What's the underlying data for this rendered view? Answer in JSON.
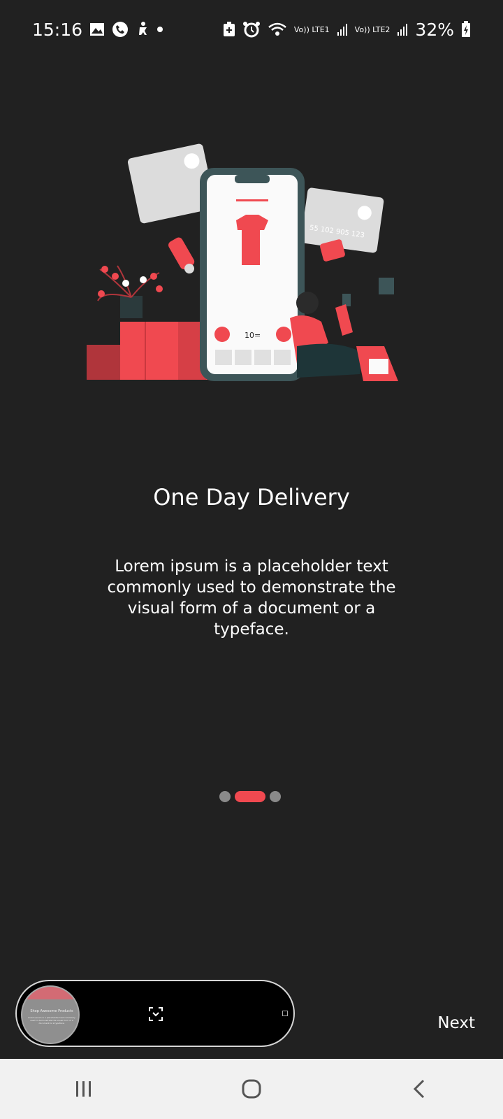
{
  "status": {
    "time": "15:16",
    "battery": "32%",
    "lte1": "Vo)) LTE1",
    "lte2": "Vo)) LTE2"
  },
  "screen": {
    "title": "One Day Delivery",
    "description": "Lorem ipsum is a placeholder text commonly used to demonstrate the visual form of a document or a typeface.",
    "page_indicator": {
      "count": 3,
      "active": 2
    },
    "next_label": "Next"
  },
  "illustration": {
    "price_tag": "10=",
    "card_number": "55 102 905 123"
  },
  "thumbnail": {
    "text": "Shop Awesome Products",
    "subtext": "Lorem ipsum is a placeholder text commonly used to demonstrate the visual form of a document or a typeface."
  },
  "colors": {
    "accent": "#f04950",
    "background": "#212121",
    "phone_frame": "#3d5558"
  }
}
